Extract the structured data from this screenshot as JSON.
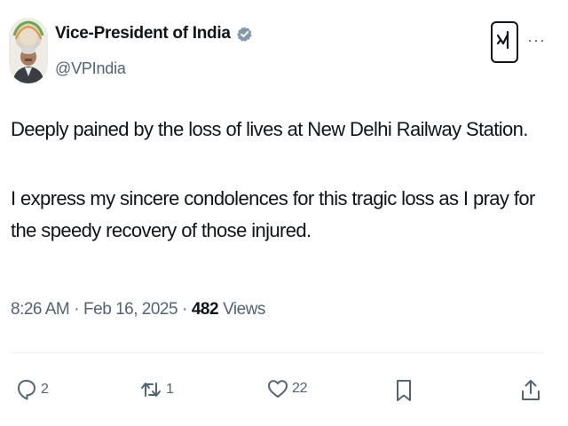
{
  "author": {
    "display_name": "Vice-President of India",
    "handle": "@VPIndia",
    "verified": true,
    "verified_color": "#829aab"
  },
  "tweet": {
    "paragraph_1": "Deeply pained by the loss of lives at New Delhi Railway Station.",
    "paragraph_2": "I express my sincere condolences for this tragic loss as I pray for the speedy recovery of those injured."
  },
  "meta": {
    "time": "8:26 AM",
    "separator": "·",
    "date": "Feb 16, 2025",
    "views_count": "482",
    "views_label": "Views"
  },
  "actions": {
    "replies": "2",
    "reposts": "1",
    "likes": "22"
  },
  "icons": {
    "reply": "speech-bubble-icon",
    "repost": "repost-arrows-icon",
    "like": "heart-icon",
    "bookmark": "bookmark-icon",
    "share": "share-icon",
    "grok": "grok-icon",
    "more": "more-dots-icon"
  },
  "more_menu_glyph": "···"
}
